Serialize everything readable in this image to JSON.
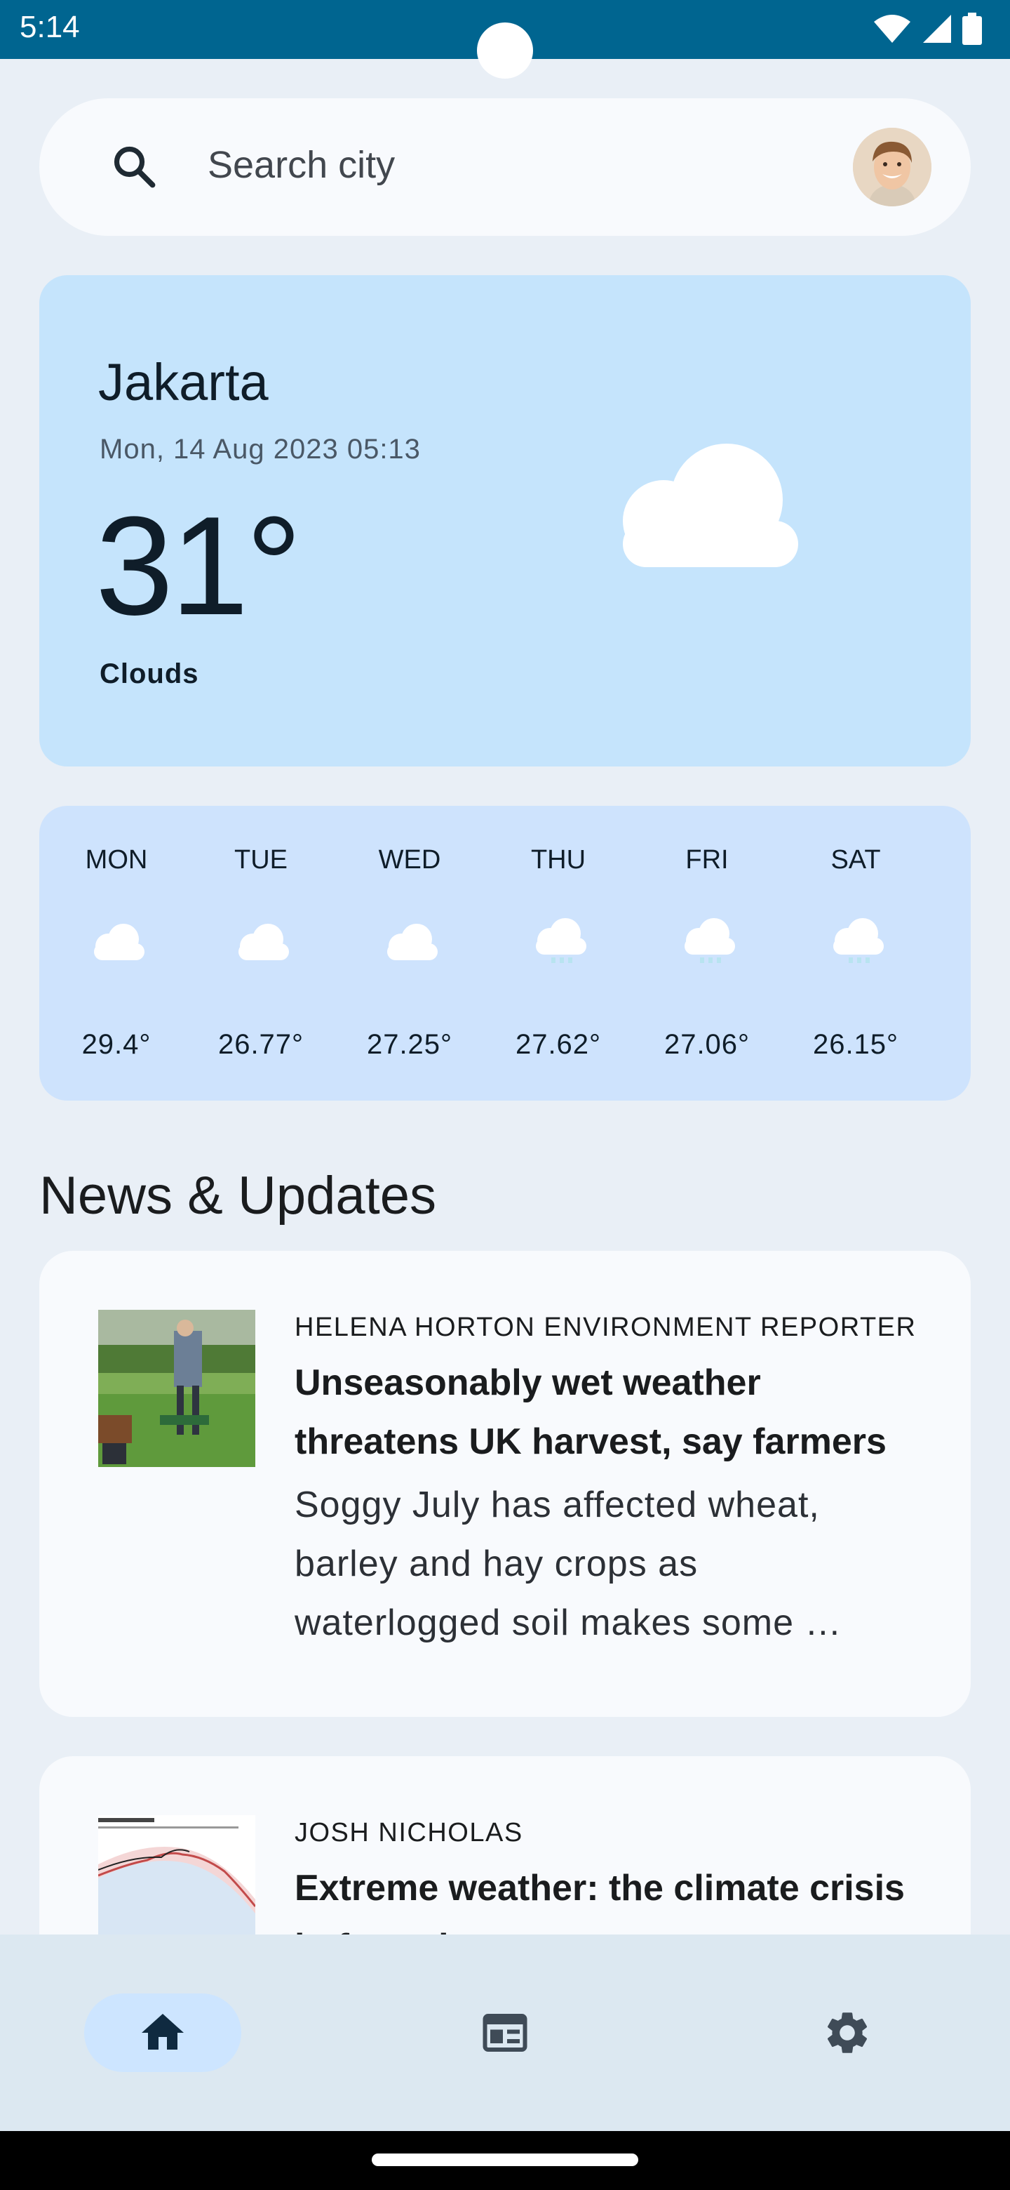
{
  "status_bar": {
    "time": "5:14"
  },
  "search": {
    "placeholder": "Search city"
  },
  "current_weather": {
    "city": "Jakarta",
    "datetime": "Mon, 14 Aug 2023 05:13",
    "temperature": "31°",
    "condition": "Clouds",
    "icon": "cloud-icon"
  },
  "forecast": [
    {
      "day": "MON",
      "temp": "29.4°",
      "icon": "cloud-icon"
    },
    {
      "day": "TUE",
      "temp": "26.77°",
      "icon": "cloud-icon"
    },
    {
      "day": "WED",
      "temp": "27.25°",
      "icon": "cloud-icon"
    },
    {
      "day": "THU",
      "temp": "27.62°",
      "icon": "rain-cloud-icon"
    },
    {
      "day": "FRI",
      "temp": "27.06°",
      "icon": "rain-cloud-icon"
    },
    {
      "day": "SAT",
      "temp": "26.15°",
      "icon": "rain-cloud-icon"
    }
  ],
  "news": {
    "section_title": "News & Updates",
    "articles": [
      {
        "author": "HELENA HORTON ENVIRONMENT REPORTER",
        "title": "Unseasonably wet weather threatens UK harvest, say farmers",
        "summary": "Soggy July has affected wheat, barley and hay crops as waterlogged soil makes some …"
      },
      {
        "author": "JOSH NICHOLAS",
        "title": "Extreme weather: the climate crisis in four charts"
      }
    ]
  },
  "bottom_nav": {
    "items": [
      {
        "icon": "home-icon",
        "active": true
      },
      {
        "icon": "newspaper-icon",
        "active": false
      },
      {
        "icon": "gear-icon",
        "active": false
      }
    ]
  },
  "colors": {
    "status_bar": "#006590",
    "weather_card": "#c5e4fc",
    "forecast_card": "#cee3fd",
    "nav_active": "#cde5ff"
  }
}
